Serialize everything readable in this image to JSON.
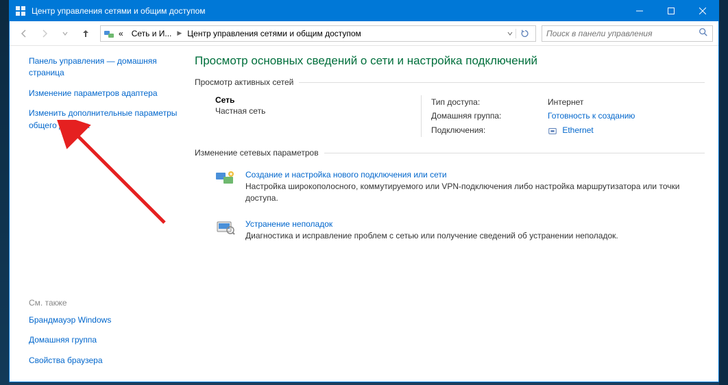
{
  "titlebar": {
    "title": "Центр управления сетями и общим доступом"
  },
  "breadcrumb": {
    "seg1": "Сеть и И...",
    "seg2": "Центр управления сетями и общим доступом"
  },
  "search": {
    "placeholder": "Поиск в панели управления"
  },
  "sidebar": {
    "home": "Панель управления — домашняя страница",
    "adapter": "Изменение параметров адаптера",
    "sharing": "Изменить дополнительные параметры общего доступа",
    "see_also_label": "См. также",
    "firewall": "Брандмауэр Windows",
    "homegroup": "Домашняя группа",
    "internet_options": "Свойства браузера"
  },
  "main": {
    "page_title": "Просмотр основных сведений о сети и настройка подключений",
    "active_networks_label": "Просмотр активных сетей",
    "network": {
      "name": "Сеть",
      "type": "Частная сеть",
      "access_type_label": "Тип доступа:",
      "access_type_value": "Интернет",
      "homegroup_label": "Домашняя группа:",
      "homegroup_value": "Готовность к созданию",
      "connections_label": "Подключения:",
      "connections_value": "Ethernet"
    },
    "change_settings_label": "Изменение сетевых параметров",
    "action1": {
      "title": "Создание и настройка нового подключения или сети",
      "desc": "Настройка широкополосного, коммутируемого или VPN-подключения либо настройка маршрутизатора или точки доступа."
    },
    "action2": {
      "title": "Устранение неполадок",
      "desc": "Диагностика и исправление проблем с сетью или получение сведений об устранении неполадок."
    }
  }
}
